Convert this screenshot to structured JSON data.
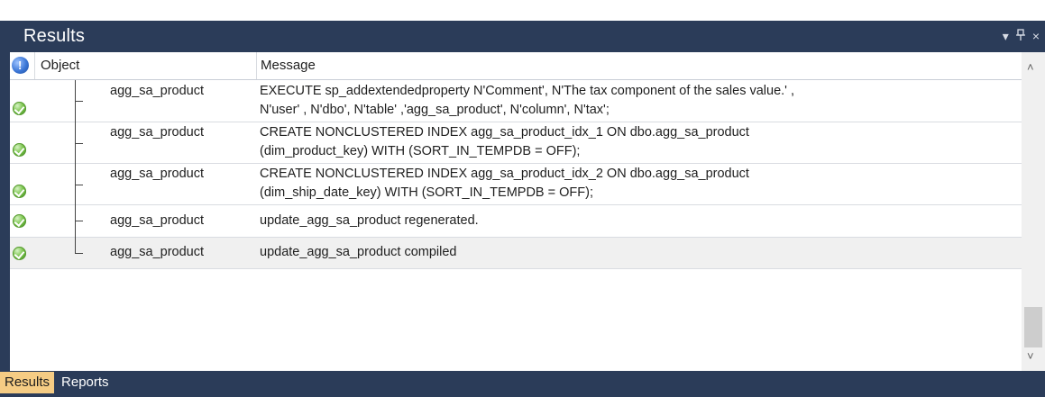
{
  "panel": {
    "title": "Results",
    "controls": {
      "dropdown": "▾",
      "pin": "ᵖ",
      "close": "×"
    }
  },
  "grid": {
    "columns": {
      "object": "Object",
      "message": "Message"
    },
    "rows": [
      {
        "object": "agg_sa_product",
        "message_lines": [
          "EXECUTE sp_addextendedproperty N'Comment', N'The tax component of the sales value.' ,",
          "N'user' , N'dbo', N'table' ,'agg_sa_product', N'column', N'tax';"
        ]
      },
      {
        "object": "agg_sa_product",
        "message_lines": [
          "CREATE NONCLUSTERED INDEX agg_sa_product_idx_1 ON dbo.agg_sa_product",
          "(dim_product_key) WITH (SORT_IN_TEMPDB = OFF);"
        ]
      },
      {
        "object": "agg_sa_product",
        "message_lines": [
          "CREATE NONCLUSTERED INDEX agg_sa_product_idx_2 ON dbo.agg_sa_product",
          "(dim_ship_date_key) WITH (SORT_IN_TEMPDB = OFF);"
        ]
      },
      {
        "object": "agg_sa_product",
        "message_lines": [
          "update_agg_sa_product regenerated."
        ]
      },
      {
        "object": "agg_sa_product",
        "message_lines": [
          "update_agg_sa_product compiled"
        ]
      }
    ]
  },
  "tabs": [
    {
      "label": "Results",
      "active": true
    },
    {
      "label": "Reports",
      "active": false
    }
  ],
  "colors": {
    "panel_bg": "#2b3c59",
    "active_tab": "#f5cc84",
    "row_alt": "#f0f0f0",
    "status_ok": "#79c34a"
  },
  "icons": {
    "header_status": "info-icon",
    "row_status": "check-ok-icon"
  }
}
